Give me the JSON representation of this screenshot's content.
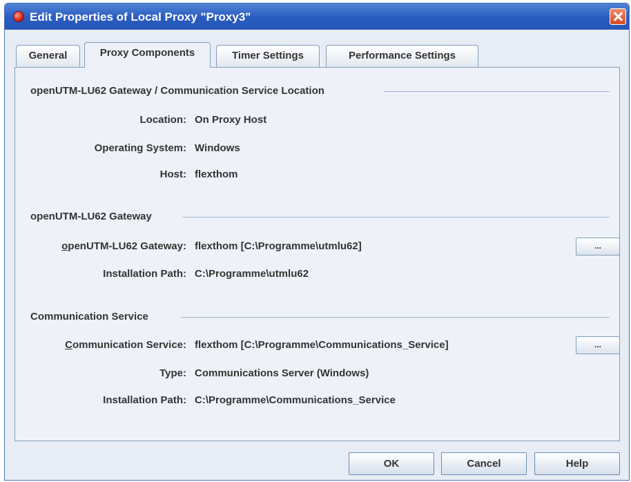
{
  "window": {
    "title": "Edit Properties of Local Proxy \"Proxy3\""
  },
  "tabs": [
    {
      "label": "General",
      "active": false
    },
    {
      "label": "Proxy Components",
      "active": true
    },
    {
      "label": "Timer Settings",
      "active": false
    },
    {
      "label": "Performance Settings",
      "active": false
    }
  ],
  "location_section": {
    "title": "openUTM-LU62 Gateway / Communication Service Location",
    "location_label": "Location:",
    "location_value": "On Proxy Host",
    "os_label": "Operating System:",
    "os_value": "Windows",
    "host_label": "Host:",
    "host_value": "flexthom"
  },
  "gateway_section": {
    "title": "openUTM-LU62 Gateway",
    "gateway_label_mnemonic": "o",
    "gateway_label_rest": "penUTM-LU62 Gateway:",
    "gateway_value": "flexthom [C:\\Programme\\utmlu62]",
    "browse_label": "...",
    "path_label": "Installation Path:",
    "path_value": "C:\\Programme\\utmlu62"
  },
  "comm_section": {
    "title": "Communication Service",
    "service_label_mnemonic": "C",
    "service_label_rest": "ommunication Service:",
    "service_value": "flexthom [C:\\Programme\\Communications_Service]",
    "browse_label": "...",
    "type_label": "Type:",
    "type_value": "Communications Server (Windows)",
    "path_label": "Installation Path:",
    "path_value": "C:\\Programme\\Communications_Service"
  },
  "buttons": {
    "ok": "OK",
    "cancel": "Cancel",
    "help": "Help"
  },
  "colors": {
    "titlebar": "#2a5cbf",
    "panel_bg": "#eef2f8",
    "border": "#7f9db9"
  }
}
